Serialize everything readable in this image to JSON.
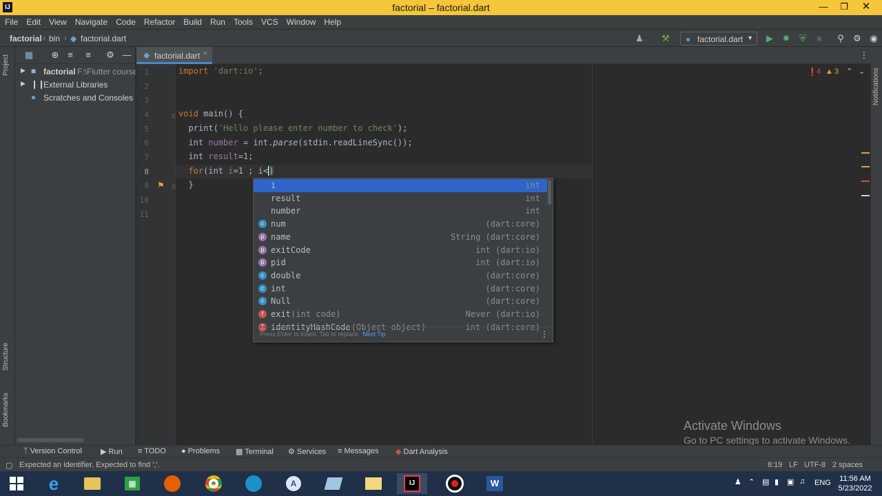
{
  "window": {
    "title": "factorial – factorial.dart",
    "app_icon_text": "IJ"
  },
  "menu": [
    "File",
    "Edit",
    "View",
    "Navigate",
    "Code",
    "Refactor",
    "Build",
    "Run",
    "Tools",
    "VCS",
    "Window",
    "Help"
  ],
  "breadcrumb": {
    "project": "factorial",
    "folder": "bin",
    "file": "factorial.dart"
  },
  "run_config": {
    "label": "factorial.dart"
  },
  "project_tree": {
    "label": "Project",
    "root_name": "factorial",
    "root_path": "F:\\Flutter course-",
    "items": [
      "External Libraries",
      "Scratches and Consoles"
    ]
  },
  "editor": {
    "tab": "factorial.dart",
    "line_numbers": [
      "1",
      "2",
      "3",
      "4",
      "5",
      "6",
      "7",
      "8",
      "9",
      "10",
      "11"
    ],
    "errors": "4",
    "warnings": "3"
  },
  "code": {
    "l1_kw": "import",
    "l1_str": " 'dart:io'",
    "l1_end": ";",
    "l4_kw": "void",
    "l4_rest": " main() {",
    "l5_a": "  print(",
    "l5_str": "'Hello please enter number to check'",
    "l5_b": ");",
    "l6_a": "  int ",
    "l6_var": "number",
    "l6_b": " = int.",
    "l6_it": "parse",
    "l6_c": "(stdin.readLineSync());",
    "l7_a": "  int ",
    "l7_var": "result",
    "l7_b": "=1;",
    "l8_kw": "  for",
    "l8_a": "(int ",
    "l8_dim": "i",
    "l8_b": "=1 ; i<",
    "l8_caret": ")",
    "l9": "  }"
  },
  "completion": {
    "items": [
      {
        "name": "i",
        "type": "int",
        "icon": ""
      },
      {
        "name": "result",
        "type": "int",
        "icon": ""
      },
      {
        "name": "number",
        "type": "int",
        "icon": ""
      },
      {
        "name": "num",
        "type": "(dart:core)",
        "icon": "c"
      },
      {
        "name": "name",
        "type": "String (dart:core)",
        "icon": "p"
      },
      {
        "name": "exitCode",
        "type": "int (dart:io)",
        "icon": "p"
      },
      {
        "name": "pid",
        "type": "int (dart:io)",
        "icon": "p"
      },
      {
        "name": "double",
        "type": "(dart:core)",
        "icon": "c"
      },
      {
        "name": "int",
        "type": "(dart:core)",
        "icon": "c"
      },
      {
        "name": "Null",
        "type": "(dart:core)",
        "icon": "c"
      },
      {
        "name": "exit",
        "params": "(int code)",
        "type": "Never (dart:io)",
        "icon": "f"
      },
      {
        "name": "identityHashCode",
        "params": "(Object object)",
        "type": "int (dart:core)",
        "icon": "f"
      }
    ],
    "footer_hint": "Press Enter to insert, Tab to replace",
    "footer_link": "Next Tip"
  },
  "side_labels": {
    "structure": "Structure",
    "bookmarks": "Bookmarks",
    "notifications": "Notifications"
  },
  "bottom_tabs": [
    "Version Control",
    "Run",
    "TODO",
    "Problems",
    "Terminal",
    "Services",
    "Messages",
    "Dart Analysis"
  ],
  "status": {
    "message": "Expected an identifier. Expected to find ';'.",
    "position": "8:19",
    "line_sep": "LF",
    "encoding": "UTF-8",
    "indent": "2 spaces"
  },
  "watermark": {
    "line1": "Activate Windows",
    "line2": "Go to PC settings to activate Windows."
  },
  "taskbar": {
    "lang": "ENG",
    "time": "11:56 AM",
    "date": "5/23/2022"
  },
  "colors": {
    "accent": "#2f65ca",
    "error": "#c75450",
    "warning": "#e0a33a",
    "titlebar": "#f5c63a"
  }
}
